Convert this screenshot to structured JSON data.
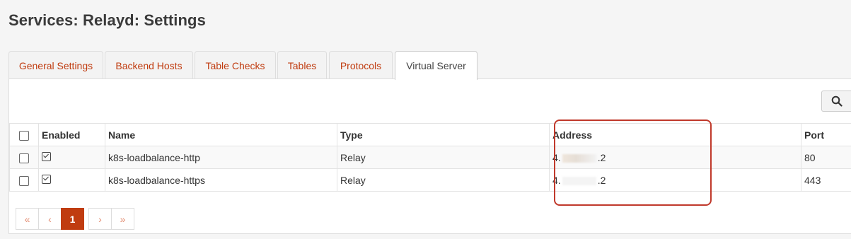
{
  "page": {
    "title": "Services: Relayd: Settings"
  },
  "tabs": [
    {
      "label": "General Settings",
      "active": false
    },
    {
      "label": "Backend Hosts",
      "active": false
    },
    {
      "label": "Table Checks",
      "active": false
    },
    {
      "label": "Tables",
      "active": false
    },
    {
      "label": "Protocols",
      "active": false
    },
    {
      "label": "Virtual Server",
      "active": true
    }
  ],
  "toolbar": {
    "search_icon": "search-icon"
  },
  "grid": {
    "columns": [
      "Enabled",
      "Name",
      "Type",
      "Address",
      "Port"
    ],
    "rows": [
      {
        "enabled": true,
        "name": "k8s-loadbalance-http",
        "type": "Relay",
        "address_prefix": "4.",
        "address_suffix": ".2",
        "port": "80"
      },
      {
        "enabled": true,
        "name": "k8s-loadbalance-https",
        "type": "Relay",
        "address_prefix": "4.",
        "address_suffix": ".2",
        "port": "443"
      }
    ]
  },
  "pagination": {
    "first": "«",
    "prev": "‹",
    "current": "1",
    "next": "›",
    "last": "»"
  },
  "colors": {
    "accent": "#c03c10",
    "highlight": "#c0392b"
  }
}
